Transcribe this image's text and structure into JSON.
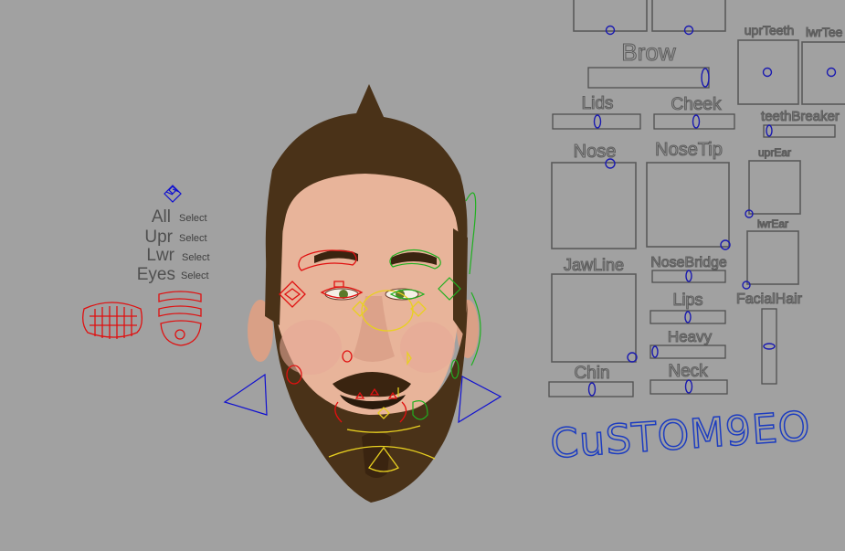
{
  "select_panel": {
    "rows": [
      {
        "name": "All",
        "action": "Select"
      },
      {
        "name": "Upr",
        "action": "Select"
      },
      {
        "name": "Lwr",
        "action": "Select"
      },
      {
        "name": "Eyes",
        "action": "Select"
      }
    ]
  },
  "picker": {
    "brow": "Brow",
    "upr_teeth": "uprTeeth",
    "lwr_teeth": "lwrTee",
    "lids": "Lids",
    "cheek": "Cheek",
    "teeth_breaker": "teethBreaker",
    "nose": "Nose",
    "nose_tip": "NoseTip",
    "upr_ear": "uprEar",
    "lwr_ear": "lwrEar",
    "jaw_line": "JawLine",
    "nose_bridge": "NoseBridge",
    "facial_hair": "FacialHair",
    "lips": "Lips",
    "heavy": "Heavy",
    "chin": "Chin",
    "neck": "Neck",
    "custom_geo": "CuSTOM9EO"
  },
  "colors": {
    "background": "#a1a1a1",
    "control_knob": "#1a1ab0",
    "rig_red": "#e01010",
    "rig_yellow": "#e8d020",
    "rig_green": "#20b020",
    "rig_blue": "#1010d0",
    "hair": "#4a3218",
    "skin": "#e8b49a"
  }
}
